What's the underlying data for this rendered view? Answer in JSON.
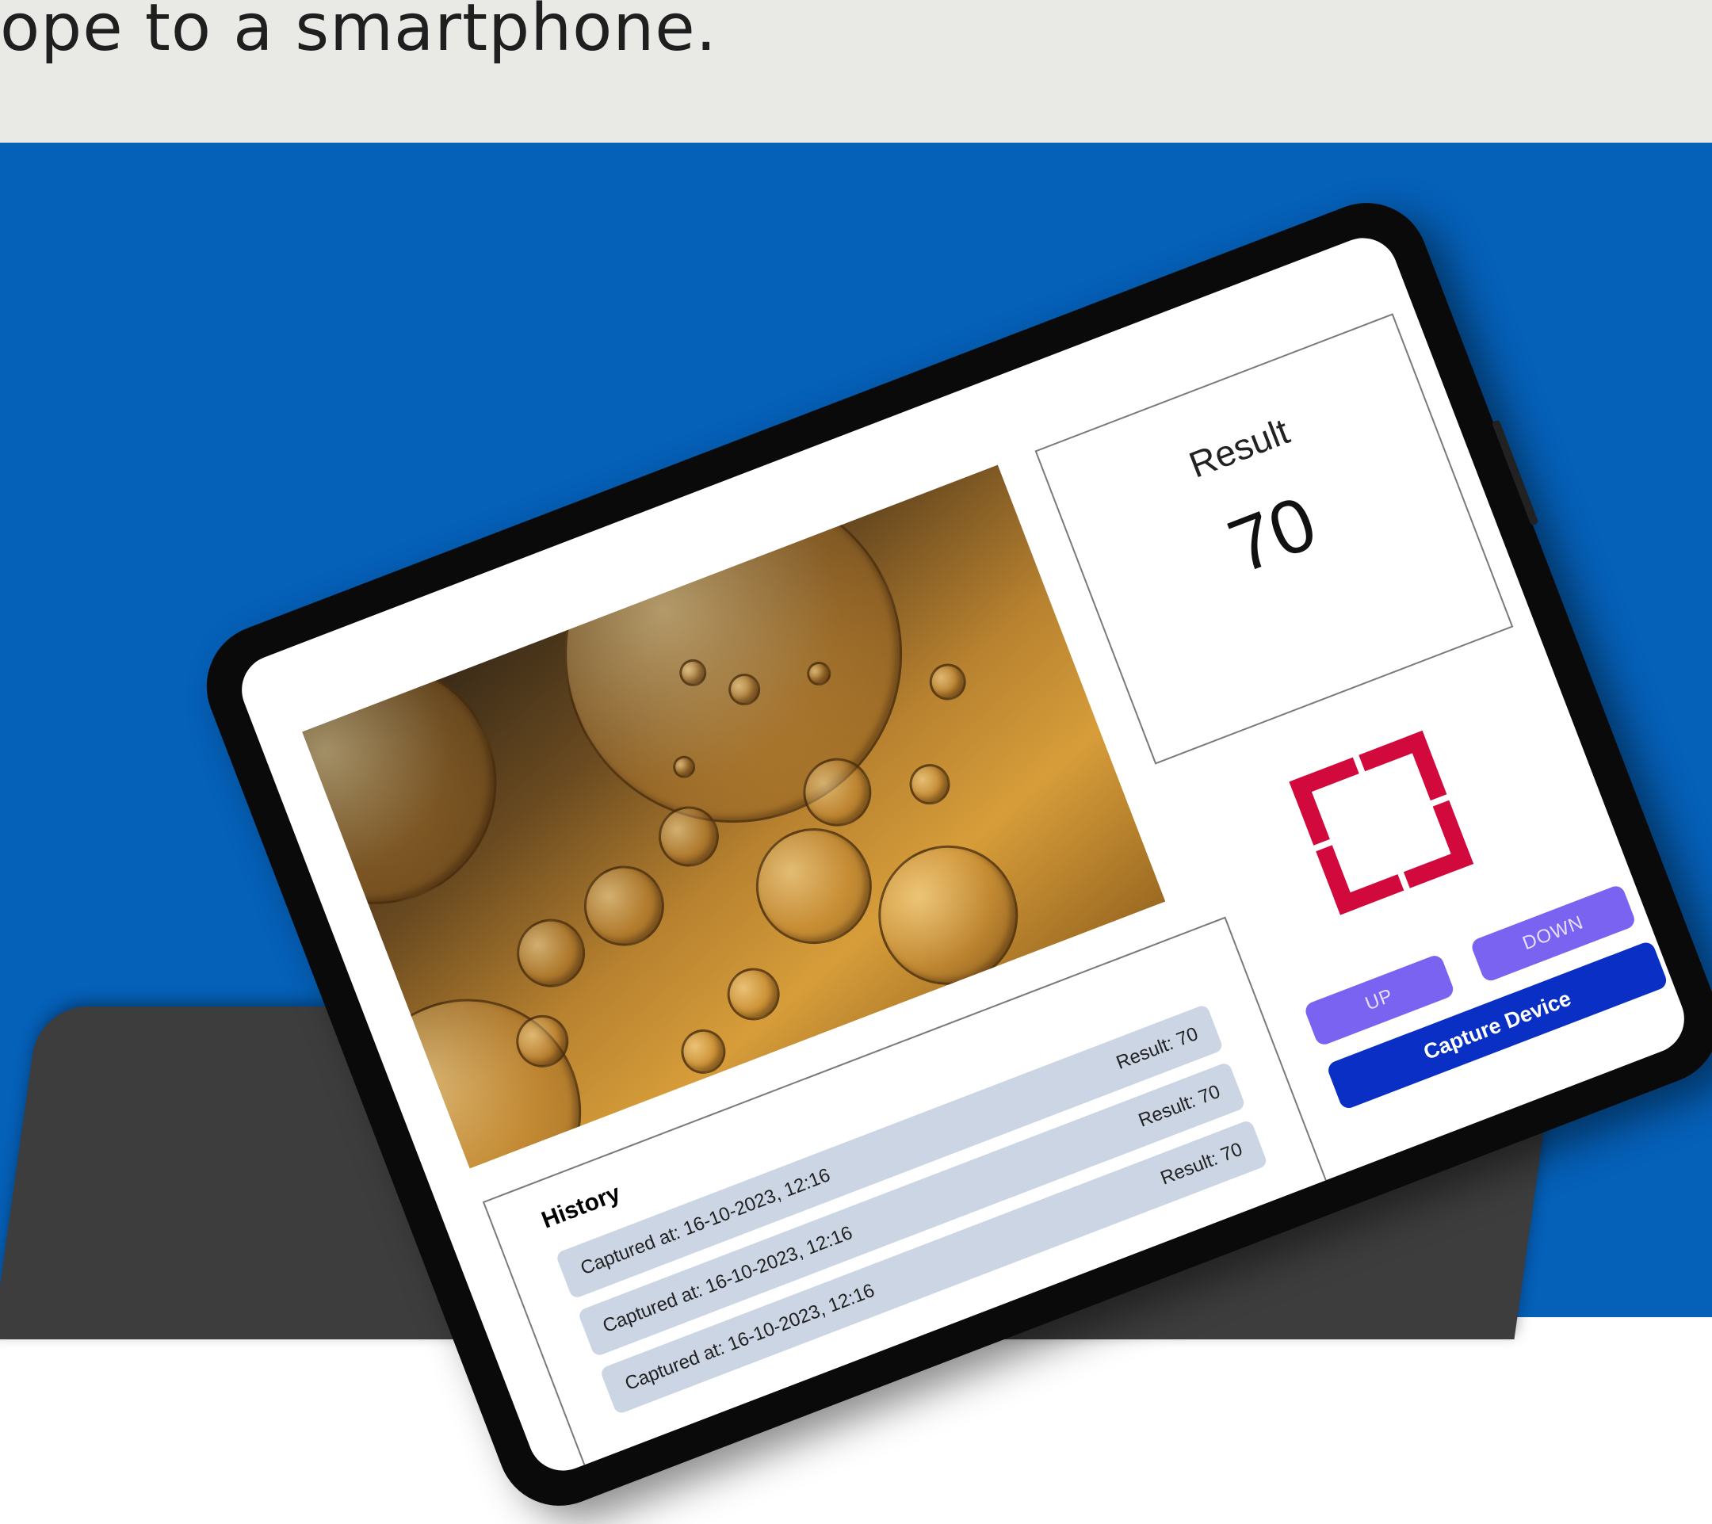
{
  "page": {
    "headline": "ope to a smartphone."
  },
  "app": {
    "result": {
      "title": "Result",
      "value": "70"
    },
    "controls": {
      "up_label": "UP",
      "down_label": "DOWN",
      "capture_label": "Capture Device"
    },
    "history": {
      "title": "History",
      "items": [
        {
          "captured": "Captured at: 16-10-2023, 12:16",
          "result": "Result: 70"
        },
        {
          "captured": "Captured at: 16-10-2023, 12:16",
          "result": "Result: 70"
        },
        {
          "captured": "Captured at: 16-10-2023, 12:16",
          "result": "Result: 70"
        }
      ]
    }
  },
  "icons": {
    "capture_frame": "capture-frame-icon"
  },
  "colors": {
    "page_band": "#e9eae6",
    "blue_background": "#0560b8",
    "accent_red": "#d1093d",
    "button_purple": "#7b63f2",
    "button_blue": "#0a2fc4",
    "history_item_bg": "#cbd5e3"
  }
}
